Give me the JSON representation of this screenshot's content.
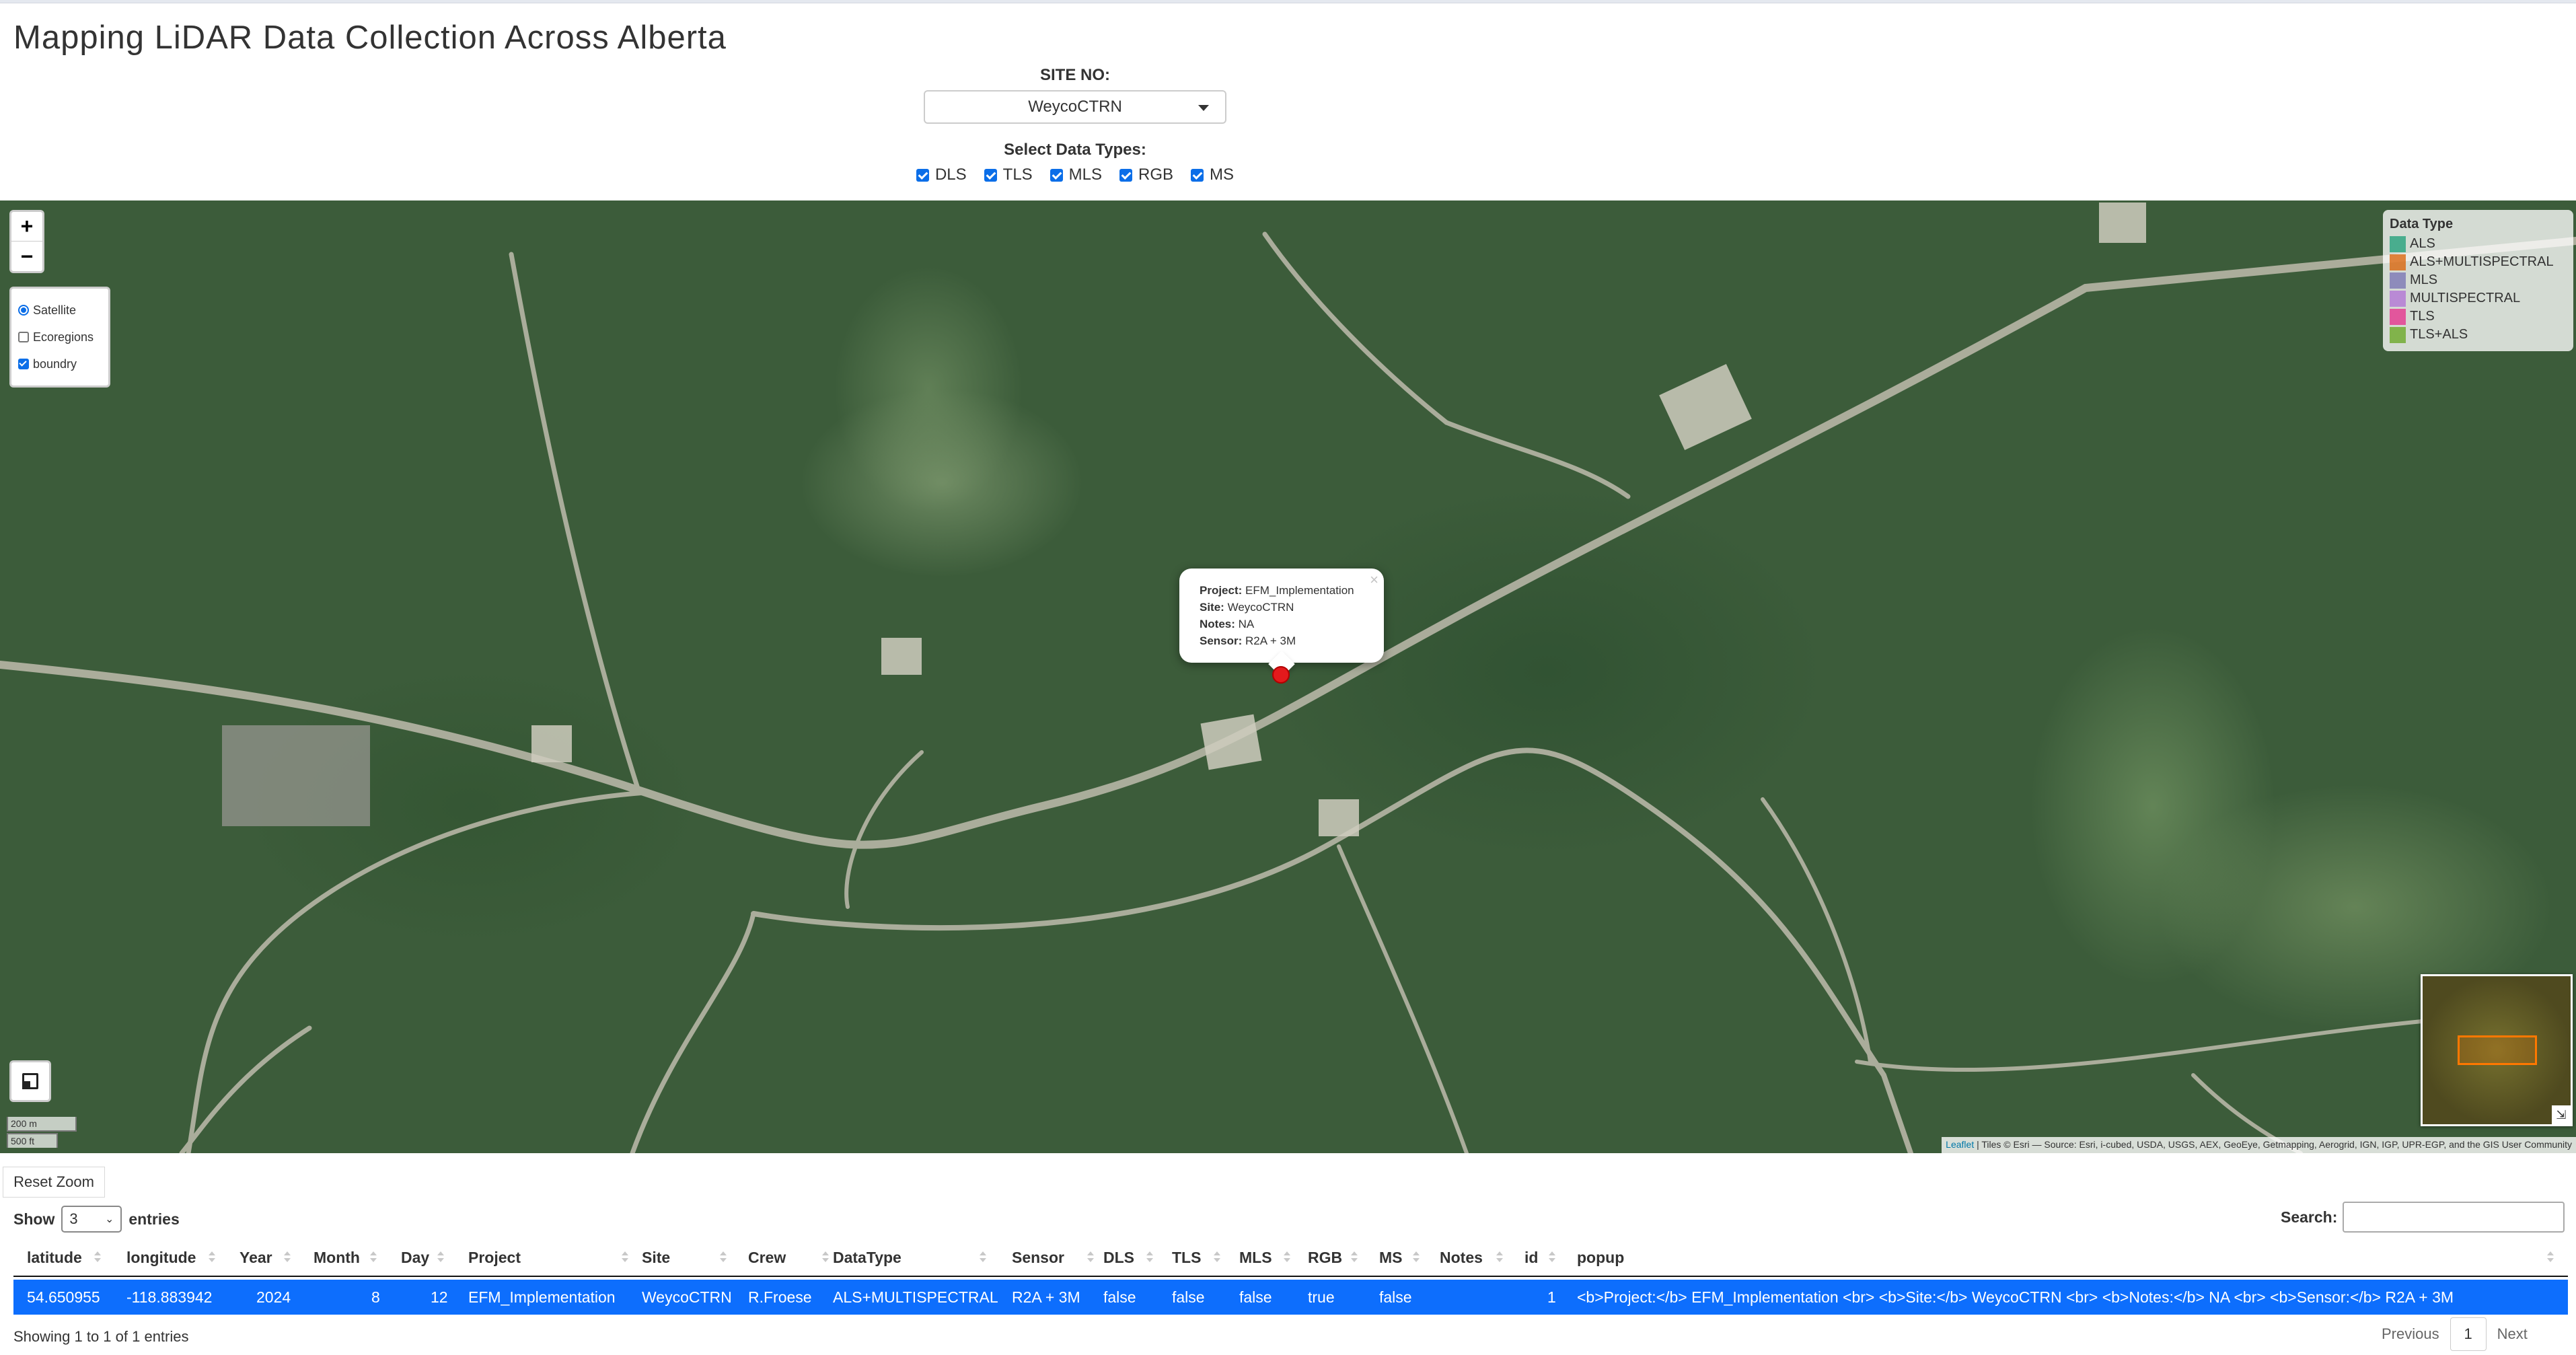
{
  "page": {
    "title": "Mapping LiDAR Data Collection Across Alberta"
  },
  "site_selector": {
    "label": "SITE NO:",
    "selected": "WeycoCTRN"
  },
  "data_types": {
    "label": "Select Data Types:",
    "options": [
      {
        "label": "DLS",
        "checked": true
      },
      {
        "label": "TLS",
        "checked": true
      },
      {
        "label": "MLS",
        "checked": true
      },
      {
        "label": "RGB",
        "checked": true
      },
      {
        "label": "MS",
        "checked": true
      }
    ]
  },
  "map": {
    "zoom_in": "+",
    "zoom_out": "−",
    "layers": [
      {
        "label": "Satellite",
        "type": "radio",
        "checked": true
      },
      {
        "label": "Ecoregions",
        "type": "checkbox",
        "checked": false
      },
      {
        "label": "boundry",
        "type": "checkbox",
        "checked": true
      }
    ],
    "legend": {
      "title": "Data Type",
      "items": [
        {
          "label": "ALS",
          "color": "#1b9e77"
        },
        {
          "label": "ALS+MULTISPECTRAL",
          "color": "#d95f02"
        },
        {
          "label": "MLS",
          "color": "#7570b3"
        },
        {
          "label": "MULTISPECTRAL",
          "color": "#b06fd6"
        },
        {
          "label": "TLS",
          "color": "#e7298a"
        },
        {
          "label": "TLS+ALS",
          "color": "#66a61e"
        }
      ]
    },
    "popup": {
      "project_label": "Project:",
      "project": "EFM_Implementation",
      "site_label": "Site:",
      "site": "WeycoCTRN",
      "notes_label": "Notes:",
      "notes": "NA",
      "sensor_label": "Sensor:",
      "sensor": "R2A + 3M",
      "close": "×"
    },
    "marker_color": "#e31a1c",
    "scale": {
      "metric": "200 m",
      "imperial": "500 ft"
    },
    "attribution": {
      "link": "Leaflet",
      "text": " | Tiles © Esri — Source: Esri, i-cubed, USDA, USGS, AEX, GeoEye, Getmapping, Aerogrid, IGN, IGP, UPR-EGP, and the GIS User Community"
    },
    "minimap_toggle": "⇲"
  },
  "controls": {
    "reset_zoom": "Reset Zoom",
    "show_label": "Show",
    "entries_value": "3",
    "entries_label": "entries",
    "search_label": "Search:"
  },
  "table": {
    "columns": [
      "latitude",
      "longitude",
      "Year",
      "Month",
      "Day",
      "Project",
      "Site",
      "Crew",
      "DataType",
      "Sensor",
      "DLS",
      "TLS",
      "MLS",
      "RGB",
      "MS",
      "Notes",
      "id",
      "popup"
    ],
    "rows": [
      [
        "54.650955",
        "-118.883942",
        "2024",
        "8",
        "12",
        "EFM_Implementation",
        "WeycoCTRN",
        "R.Froese",
        "ALS+MULTISPECTRAL",
        "R2A + 3M",
        "false",
        "false",
        "false",
        "true",
        "false",
        "",
        "1",
        "<b>Project:</b> EFM_Implementation <br> <b>Site:</b> WeycoCTRN <br> <b>Notes:</b> NA <br> <b>Sensor:</b> R2A + 3M"
      ]
    ],
    "info": "Showing 1 to 1 of 1 entries",
    "pager": {
      "previous": "Previous",
      "page": "1",
      "next": "Next"
    }
  }
}
